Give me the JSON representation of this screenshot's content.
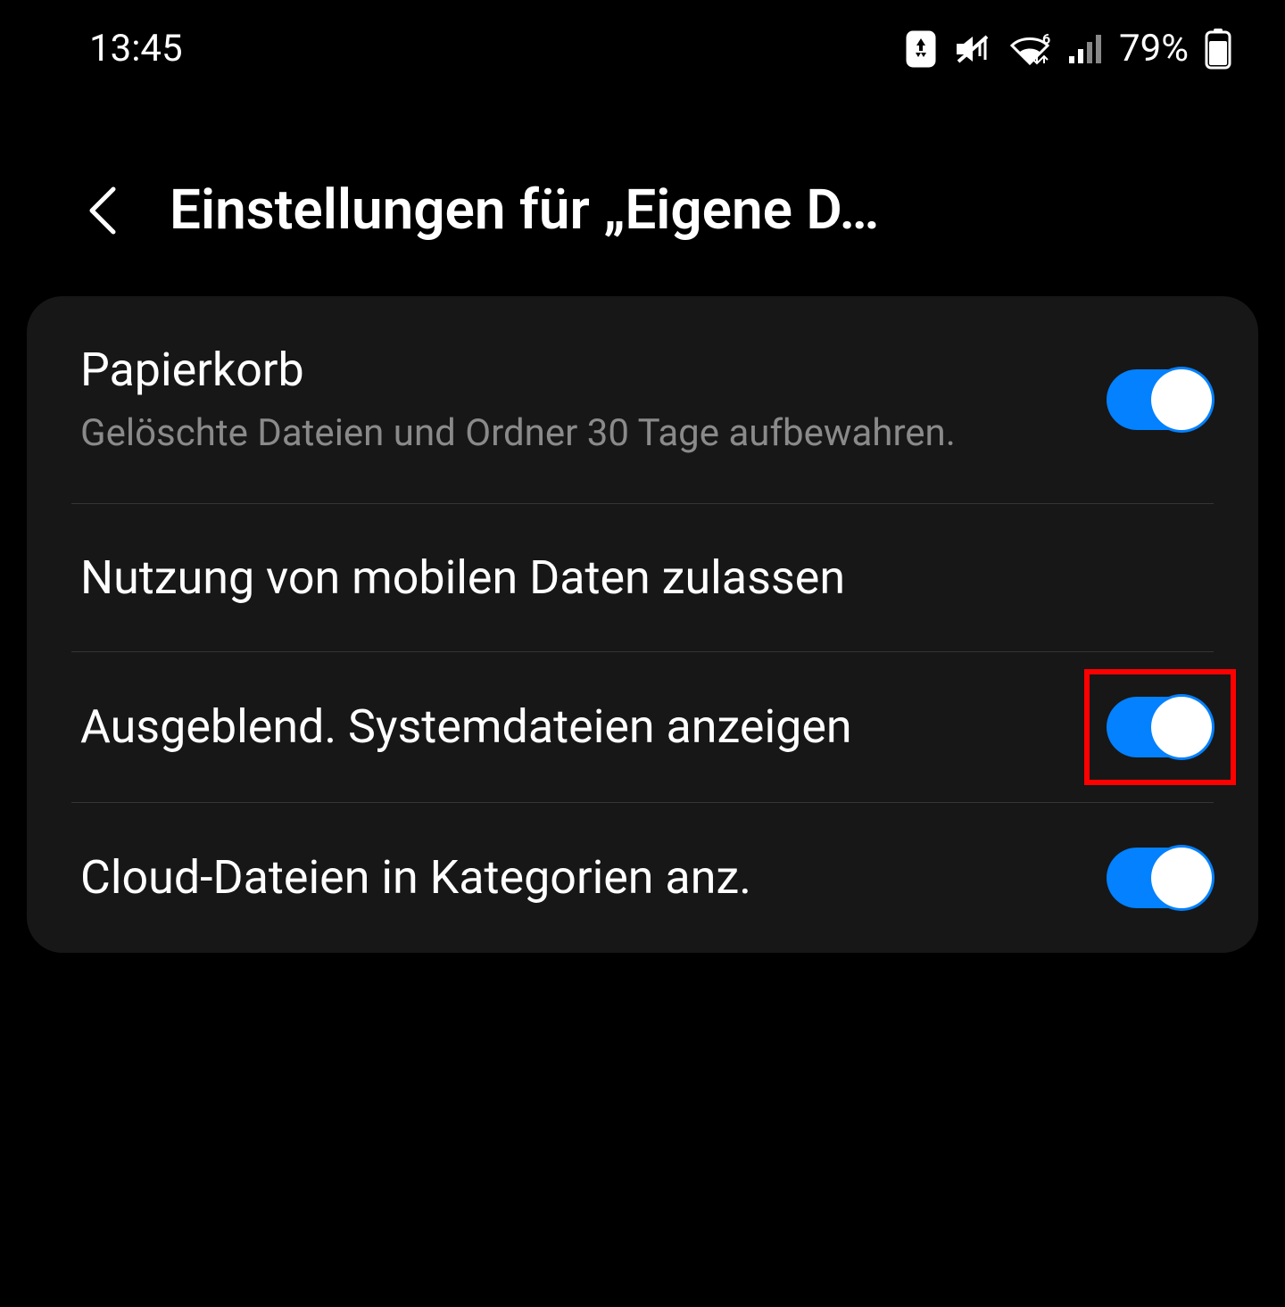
{
  "statusBar": {
    "time": "13:45",
    "batteryPercent": "79%"
  },
  "header": {
    "title": "Einstellungen für „Eigene D…"
  },
  "settings": {
    "trash": {
      "title": "Papierkorb",
      "subtitle": "Gelöschte Dateien und Ordner 30 Tage aufbewahren.",
      "enabled": true
    },
    "mobileData": {
      "title": "Nutzung von mobilen Daten zulassen"
    },
    "hiddenSystemFiles": {
      "title": "Ausgeblend. Systemdateien anzeigen",
      "enabled": true,
      "highlighted": true
    },
    "cloudFiles": {
      "title": "Cloud-Dateien in Kategorien anz.",
      "enabled": true
    }
  }
}
